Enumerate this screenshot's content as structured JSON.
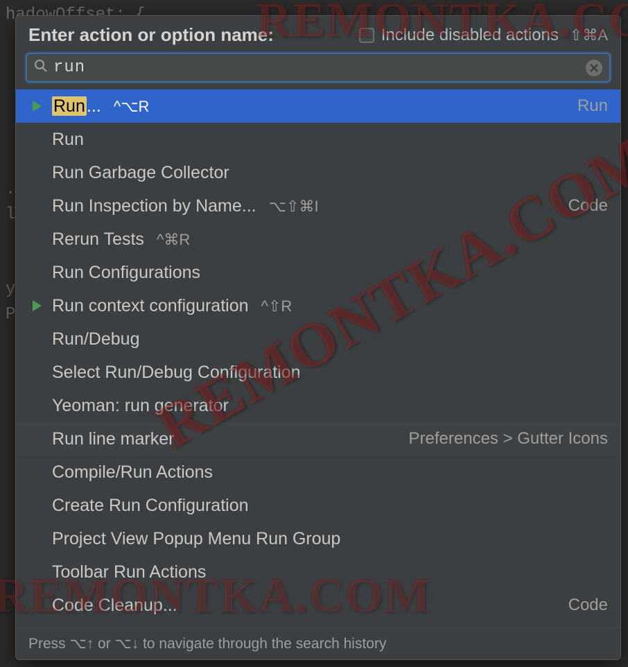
{
  "background_code": "hadowOffset: {\n\n\n\n\n\n\n.toSt\nlackKey/>\n\n\nype\nPropTypes",
  "watermark": "REMONTKA.COM",
  "header": {
    "title": "Enter action or option name:",
    "checkbox_label": "Include disabled actions",
    "checkbox_shortcut": "⇧⌘A"
  },
  "search": {
    "value": "run",
    "placeholder": ""
  },
  "results": [
    {
      "icon": "play",
      "highlight": "Run",
      "rest": "...",
      "shortcut": "^⌥R",
      "group": "Run",
      "selected": true
    },
    {
      "icon": "",
      "highlight": "",
      "rest": "Run",
      "shortcut": "",
      "group": ""
    },
    {
      "icon": "",
      "highlight": "",
      "rest": "Run Garbage Collector",
      "shortcut": "",
      "group": ""
    },
    {
      "icon": "",
      "highlight": "",
      "rest": "Run Inspection by Name...",
      "shortcut": "⌥⇧⌘I",
      "group": "Code"
    },
    {
      "icon": "",
      "highlight": "",
      "rest": "Rerun Tests",
      "shortcut": "^⌘R",
      "group": ""
    },
    {
      "icon": "",
      "highlight": "",
      "rest": "Run Configurations",
      "shortcut": "",
      "group": ""
    },
    {
      "icon": "play",
      "highlight": "",
      "rest": "Run context configuration",
      "shortcut": "^⇧R",
      "group": ""
    },
    {
      "icon": "",
      "highlight": "",
      "rest": "Run/Debug",
      "shortcut": "",
      "group": ""
    },
    {
      "icon": "",
      "highlight": "",
      "rest": "Select Run/Debug Configuration",
      "shortcut": "",
      "group": ""
    },
    {
      "icon": "",
      "highlight": "",
      "rest": "Yeoman: run generator",
      "shortcut": "",
      "group": ""
    },
    {
      "icon": "",
      "highlight": "",
      "rest": "Run line marker",
      "shortcut": "",
      "group": "Preferences > Gutter Icons",
      "shaded": true
    },
    {
      "icon": "",
      "highlight": "",
      "rest": "Compile/Run Actions",
      "shortcut": "",
      "group": ""
    },
    {
      "icon": "",
      "highlight": "",
      "rest": "Create Run Configuration",
      "shortcut": "",
      "group": ""
    },
    {
      "icon": "",
      "highlight": "",
      "rest": "Project View Popup Menu Run Group",
      "shortcut": "",
      "group": ""
    },
    {
      "icon": "",
      "highlight": "",
      "rest": "Toolbar Run Actions",
      "shortcut": "",
      "group": ""
    },
    {
      "icon": "",
      "highlight": "",
      "rest": "Code Cleanup...",
      "shortcut": "",
      "group": "Code"
    }
  ],
  "hint": "Press ⌥↑ or ⌥↓ to navigate through the search history"
}
